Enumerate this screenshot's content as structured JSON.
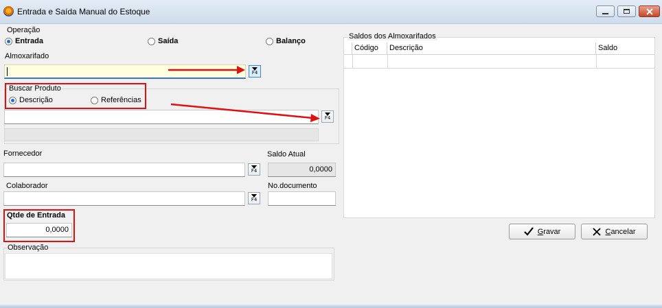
{
  "window": {
    "title": "Entrada e Saída Manual do Estoque",
    "buttons": [
      "minimize",
      "maximize",
      "close"
    ]
  },
  "operacao": {
    "label": "Operação",
    "options": [
      {
        "label": "Entrada",
        "selected": true
      },
      {
        "label": "Saída",
        "selected": false
      },
      {
        "label": "Balanço",
        "selected": false
      }
    ]
  },
  "almoxarifado": {
    "label": "Almoxarifado",
    "value": "",
    "lookup_key": "F4"
  },
  "buscar_produto": {
    "label": "Buscar Produto",
    "options": [
      {
        "label": "Descrição",
        "selected": true
      },
      {
        "label": "Referências",
        "selected": false
      }
    ],
    "value": "",
    "lookup_key": "F4"
  },
  "fornecedor": {
    "label": "Fornecedor",
    "value": "",
    "lookup_key": "F4"
  },
  "saldo_atual": {
    "label": "Saldo Atual",
    "value": "0,0000"
  },
  "colaborador": {
    "label": "Colaborador",
    "value": "",
    "lookup_key": "F4"
  },
  "no_documento": {
    "label": "No.documento",
    "value": ""
  },
  "qtde_entrada": {
    "label": "Qtde de Entrada",
    "value": "0,0000"
  },
  "observacao": {
    "label": "Observação",
    "value": ""
  },
  "saldos": {
    "label": "Saldos dos Almoxarifados",
    "columns": [
      "Código",
      "Descrição",
      "Saldo"
    ]
  },
  "actions": {
    "gravar": "Gravar",
    "cancelar": "Cancelar"
  },
  "colors": {
    "highlight": "#e01010",
    "focus_field": "#ffffe0",
    "accent": "#1d6fd6"
  },
  "icons": [
    "app-icon",
    "f4-lookup-icon",
    "check-icon",
    "x-icon",
    "arrow-annotation"
  ]
}
